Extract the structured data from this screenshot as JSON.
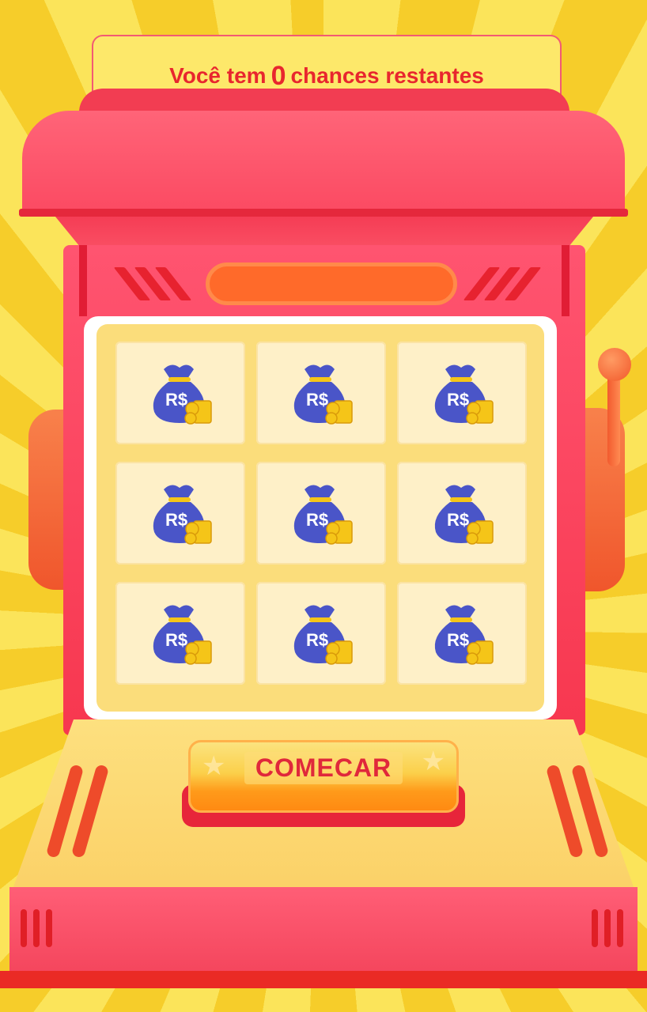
{
  "header": {
    "text_before": "Você tem",
    "chances_count": "0",
    "text_after": "chances restantes"
  },
  "grid": {
    "cells": [
      {
        "label": "R$"
      },
      {
        "label": "R$"
      },
      {
        "label": "R$"
      },
      {
        "label": "R$"
      },
      {
        "label": "R$"
      },
      {
        "label": "R$"
      },
      {
        "label": "R$"
      },
      {
        "label": "R$"
      },
      {
        "label": "R$"
      }
    ],
    "icon": "money-bag-icon"
  },
  "start_button": {
    "label": "COMECAR"
  },
  "colors": {
    "machine_red": "#fb4a62",
    "accent_orange": "#ff6a2a",
    "screen_yellow": "#fbdd7b",
    "bag_blue": "#4a55c8",
    "coin_gold": "#f5c518",
    "text_red": "#e8262e"
  }
}
